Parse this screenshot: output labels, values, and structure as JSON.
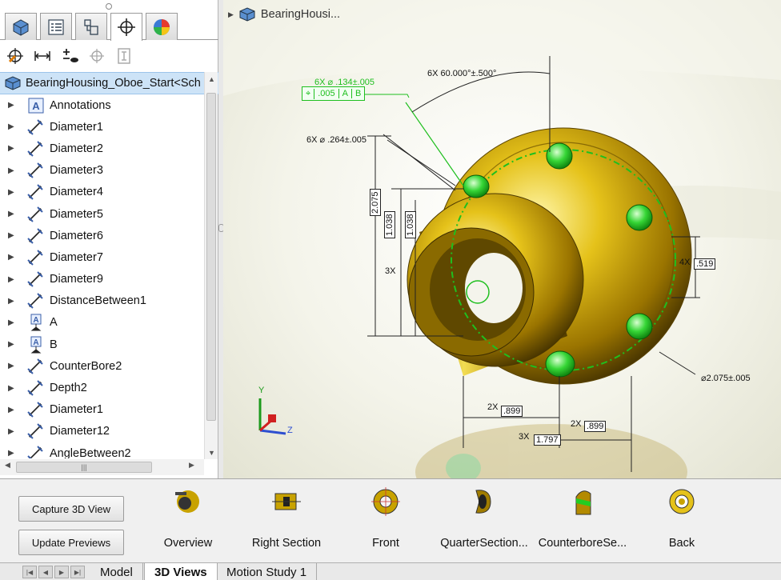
{
  "feature_tree": {
    "root_label": "BearingHousing_Oboe_Start<Sch",
    "items": [
      {
        "label": "Annotations",
        "icon": "annotations-icon"
      },
      {
        "label": "Diameter1",
        "icon": "dimension-icon"
      },
      {
        "label": "Diameter2",
        "icon": "dimension-icon"
      },
      {
        "label": "Diameter3",
        "icon": "dimension-icon"
      },
      {
        "label": "Diameter4",
        "icon": "dimension-icon"
      },
      {
        "label": "Diameter5",
        "icon": "dimension-icon"
      },
      {
        "label": "Diameter6",
        "icon": "dimension-icon"
      },
      {
        "label": "Diameter7",
        "icon": "dimension-icon"
      },
      {
        "label": "Diameter9",
        "icon": "dimension-icon"
      },
      {
        "label": "DistanceBetween1",
        "icon": "dimension-icon"
      },
      {
        "label": "A",
        "icon": "datum-icon"
      },
      {
        "label": "B",
        "icon": "datum-icon"
      },
      {
        "label": "CounterBore2",
        "icon": "dimension-icon"
      },
      {
        "label": "Depth2",
        "icon": "dimension-icon"
      },
      {
        "label": "Diameter1",
        "icon": "dimension-icon"
      },
      {
        "label": "Diameter12",
        "icon": "dimension-icon"
      },
      {
        "label": "AngleBetween2",
        "icon": "dimension-icon"
      }
    ]
  },
  "viewport": {
    "breadcrumb": "BearingHousi...",
    "annotations": {
      "hole_callout_top": "6X ⌀ .134±.005",
      "fcf_tolerance": ".005",
      "fcf_datum_a": "A",
      "fcf_datum_b": "B",
      "angle": "6X 60.000°±.500°",
      "hole_dia": "6X ⌀ .264±.005",
      "height": "2.075",
      "count_3x": "3X",
      "height_half": "1.038",
      "height_half2": "1.038",
      "count_4x": "4X",
      "width_519": ".519",
      "outer_dia": "⌀2.075±.005",
      "count_2x_a": "2X",
      "val_899_a": ".899",
      "count_2x_b": "2X",
      "val_899_b": ".899",
      "count_3x_b": "3X",
      "val_1797": "1.797"
    },
    "triad": {
      "y": "Y",
      "z": "Z"
    }
  },
  "bottom_panel": {
    "capture_button": "Capture 3D View",
    "update_button": "Update Previews",
    "views": [
      {
        "label": "Overview"
      },
      {
        "label": "Right Section"
      },
      {
        "label": "Front"
      },
      {
        "label": "QuarterSection..."
      },
      {
        "label": "CounterboreSe..."
      },
      {
        "label": "Back"
      }
    ]
  },
  "tabs": {
    "model": "Model",
    "views3d": "3D Views",
    "motion": "Motion Study 1"
  },
  "colors": {
    "selection": "#cde3f7",
    "gold": "#c8a200",
    "green": "#22cc22",
    "dim_blue": "#2e4fd0"
  }
}
